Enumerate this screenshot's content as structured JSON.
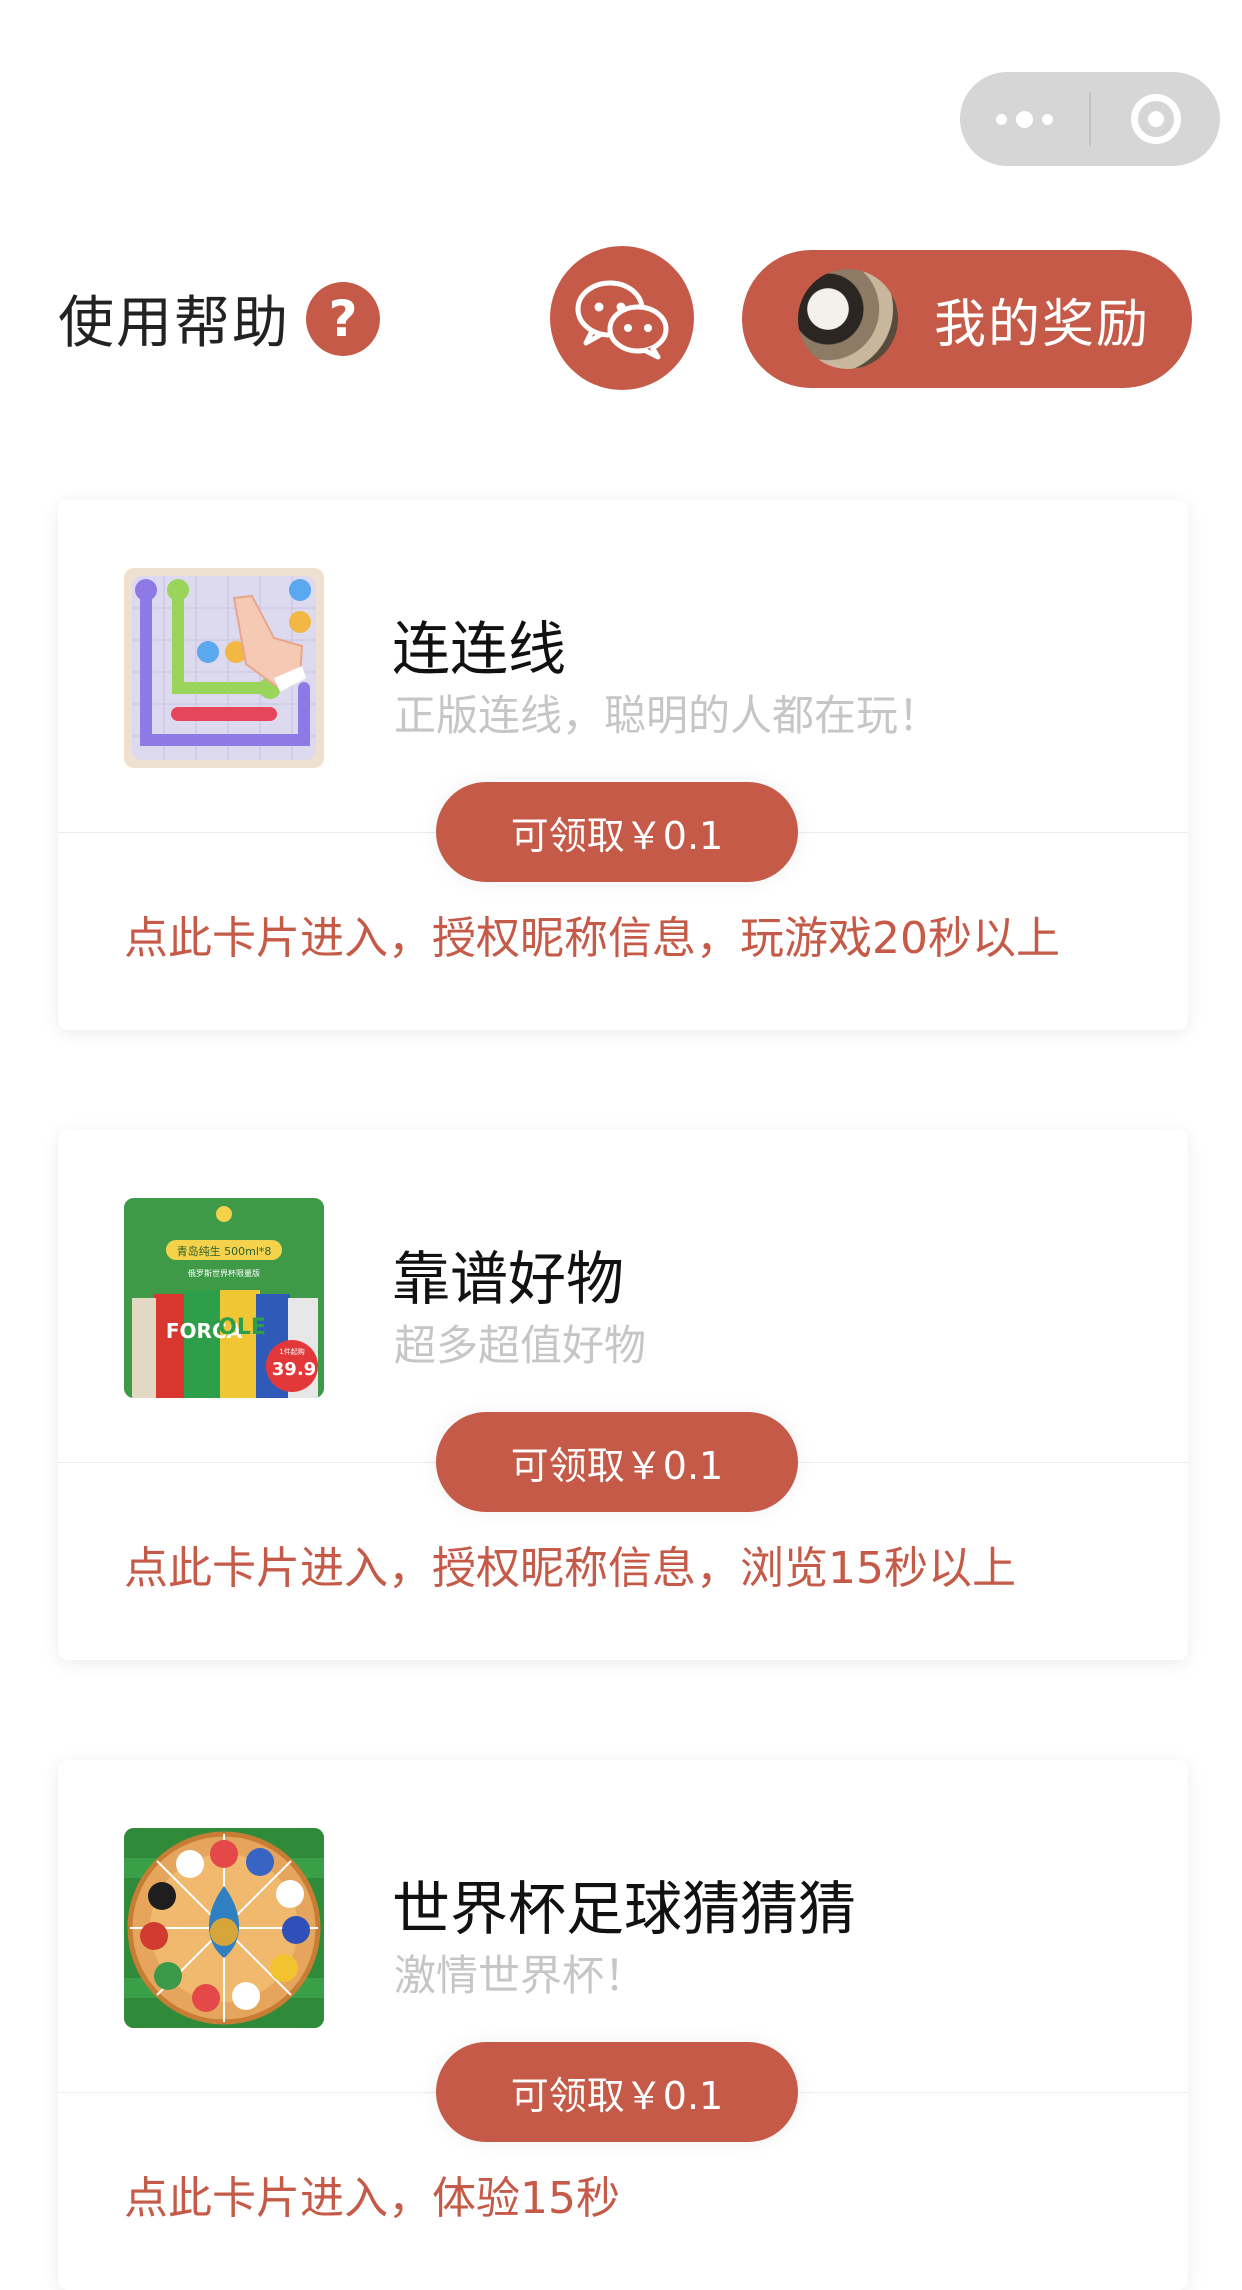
{
  "accent_color": "#c45a47",
  "capsule": {
    "more_icon": "more-dots-icon",
    "close_icon": "target-circle-icon"
  },
  "header": {
    "help_label": "使用帮助",
    "help_icon_glyph": "?",
    "wechat_icon": "wechat-chat-icon",
    "reward_label": "我的奖励"
  },
  "cards": [
    {
      "title": "连连线",
      "subtitle": "正版连线，聪明的人都在玩！",
      "claim_label": "可领取￥0.1",
      "instruction": "点此卡片进入，授权昵称信息，玩游戏20秒以上",
      "thumb_icon": "line-puzzle-game-icon"
    },
    {
      "title": "靠谱好物",
      "subtitle": "超多超值好物",
      "claim_label": "可领取￥0.1",
      "instruction": "点此卡片进入，授权昵称信息，浏览15秒以上",
      "thumb_icon": "beer-cans-product-icon",
      "thumb_text": {
        "top": "青岛纯生 500ml*8",
        "sub": "俄罗斯世界杯限量版",
        "can": "FORCA",
        "can2": "OLE",
        "price": "39.9",
        "price_label": "1件起购"
      }
    },
    {
      "title": "世界杯足球猜猜猜",
      "subtitle": "激情世界杯！",
      "claim_label": "可领取￥0.1",
      "instruction": "点此卡片进入，体验15秒",
      "thumb_icon": "world-cup-wheel-icon"
    }
  ]
}
